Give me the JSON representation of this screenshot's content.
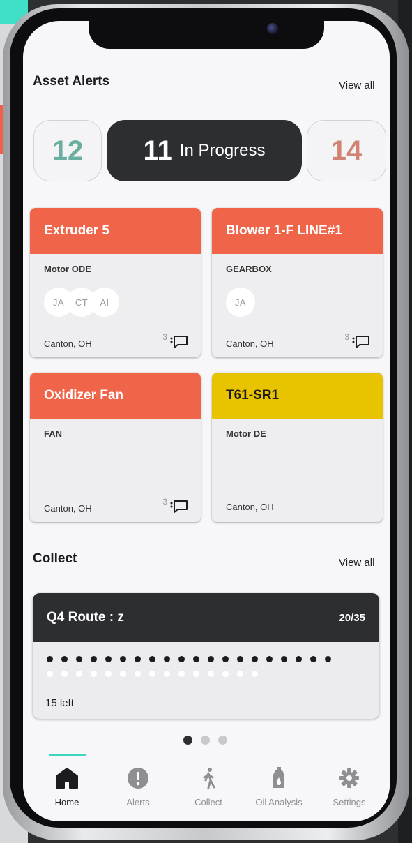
{
  "asset_alerts": {
    "title": "Asset Alerts",
    "view_all": "View all",
    "stats": {
      "left": {
        "value": "12",
        "color": "#6aaea0"
      },
      "center": {
        "value": "11",
        "label": "In Progress"
      },
      "right": {
        "value": "14",
        "color": "#d18474"
      }
    },
    "cards": [
      {
        "name": "Extruder 5",
        "component": "Motor ODE",
        "location": "Canton, OH",
        "comments": "3",
        "header_color": "#f0654a",
        "avatars": [
          "JA",
          "CT",
          "AI"
        ]
      },
      {
        "name": "Blower 1-F LINE#1",
        "component": "GEARBOX",
        "location": "Canton, OH",
        "comments": "3",
        "header_color": "#f0654a",
        "avatars": [
          "JA"
        ]
      },
      {
        "name": "Oxidizer Fan",
        "component": "FAN",
        "location": "Canton, OH",
        "comments": "3",
        "header_color": "#f0654a",
        "avatars": []
      },
      {
        "name": "T61-SR1",
        "component": "Motor DE",
        "location": "Canton, OH",
        "comments": "",
        "header_color": "#e8c300",
        "avatars": []
      }
    ]
  },
  "collect": {
    "title": "Collect",
    "view_all": "View all",
    "route": {
      "name": "Q4 Route : z",
      "progress": "20/35",
      "completed": 20,
      "total": 35,
      "remaining_label": "15 left"
    },
    "pager": {
      "pages": 3,
      "active": 0
    }
  },
  "tabbar": {
    "active": "home",
    "accent": "#3dd6bf",
    "tabs": [
      {
        "id": "home",
        "label": "Home",
        "icon": "home-icon"
      },
      {
        "id": "alerts",
        "label": "Alerts",
        "icon": "alert-icon"
      },
      {
        "id": "collect",
        "label": "Collect",
        "icon": "walking-person-icon"
      },
      {
        "id": "oil",
        "label": "Oil Analysis",
        "icon": "oil-bottle-icon"
      },
      {
        "id": "settings",
        "label": "Settings",
        "icon": "gear-icon"
      }
    ]
  }
}
